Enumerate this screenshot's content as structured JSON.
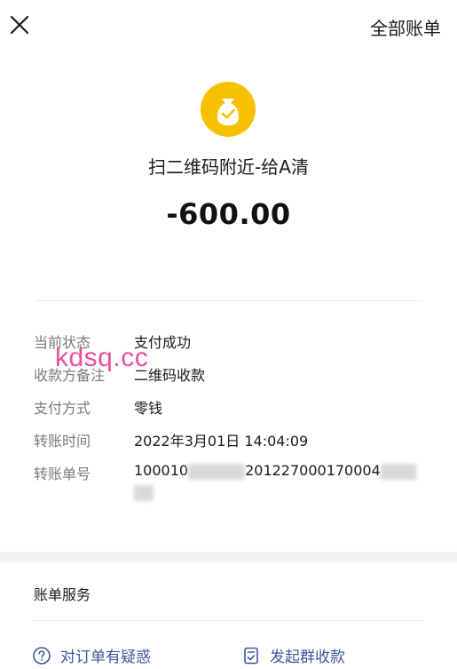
{
  "header": {
    "close_icon": "close-icon",
    "all_bills_label": "全部账单"
  },
  "transaction": {
    "icon": "money-bag-check-icon",
    "icon_color": "#f7c100",
    "merchant": "扫二维码附近-给A清",
    "amount": "-600.00"
  },
  "details": [
    {
      "label": "当前状态",
      "value": "支付成功"
    },
    {
      "label": "收款方备注",
      "value": "二维码收款"
    },
    {
      "label": "支付方式",
      "value": "零钱"
    },
    {
      "label": "转账时间",
      "value": "2022年3月01日 14:04:09"
    },
    {
      "label": "转账单号",
      "value_visible_a": "100010",
      "value_visible_b": "201227000170004"
    }
  ],
  "watermark": "kdsq.cc",
  "services": {
    "title": "账单服务",
    "items": [
      {
        "icon": "question-circle-icon",
        "label": "对订单有疑惑"
      },
      {
        "icon": "document-check-icon",
        "label": "发起群收款"
      }
    ],
    "link_color": "#3b5998"
  }
}
